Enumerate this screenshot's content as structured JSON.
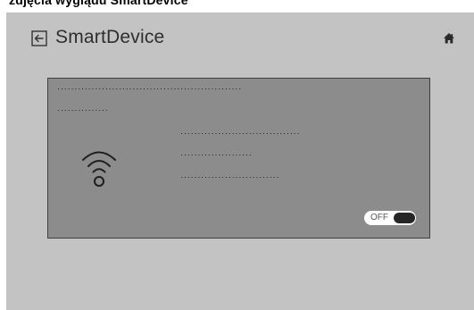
{
  "caption": {
    "text": "zdjęcia wyglądu SmartDevice"
  },
  "header": {
    "title": "SmartDevice",
    "back_icon": "back-arrow-icon",
    "home_icon": "home-icon"
  },
  "device_card": {
    "icon": "wifi-icon",
    "text_lines": [
      "······················································",
      "···············",
      "···································",
      "·····················",
      "·····························"
    ],
    "toggle": {
      "label": "OFF",
      "state": "off"
    }
  },
  "colors": {
    "screen_background": "#c3c3c3",
    "card_background": "#8c8c8c",
    "card_border": "#3f3f3f",
    "toggle_knob": "#262626"
  }
}
